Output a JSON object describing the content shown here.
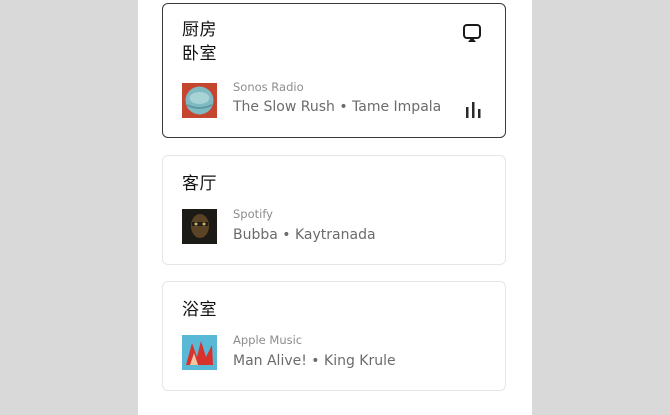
{
  "rooms": [
    {
      "name": "厨房\n卧室",
      "service": "Sonos Radio",
      "track": "The Slow Rush • Tame Impala",
      "active": true,
      "icons": [
        "airplay-icon",
        "equalizer-icon"
      ]
    },
    {
      "name": "客厅",
      "service": "Spotify",
      "track": "Bubba • Kaytranada",
      "active": false
    },
    {
      "name": "浴室",
      "service": "Apple Music",
      "track": "Man Alive! • King Krule",
      "active": false
    }
  ],
  "colors": {
    "background": "#d9d9d9",
    "card_active_border": "#3a3a3a",
    "card_border": "#e6e6e6",
    "text_primary": "#111111",
    "text_secondary": "#6b6b6b",
    "text_tertiary": "#8d8d8d"
  }
}
